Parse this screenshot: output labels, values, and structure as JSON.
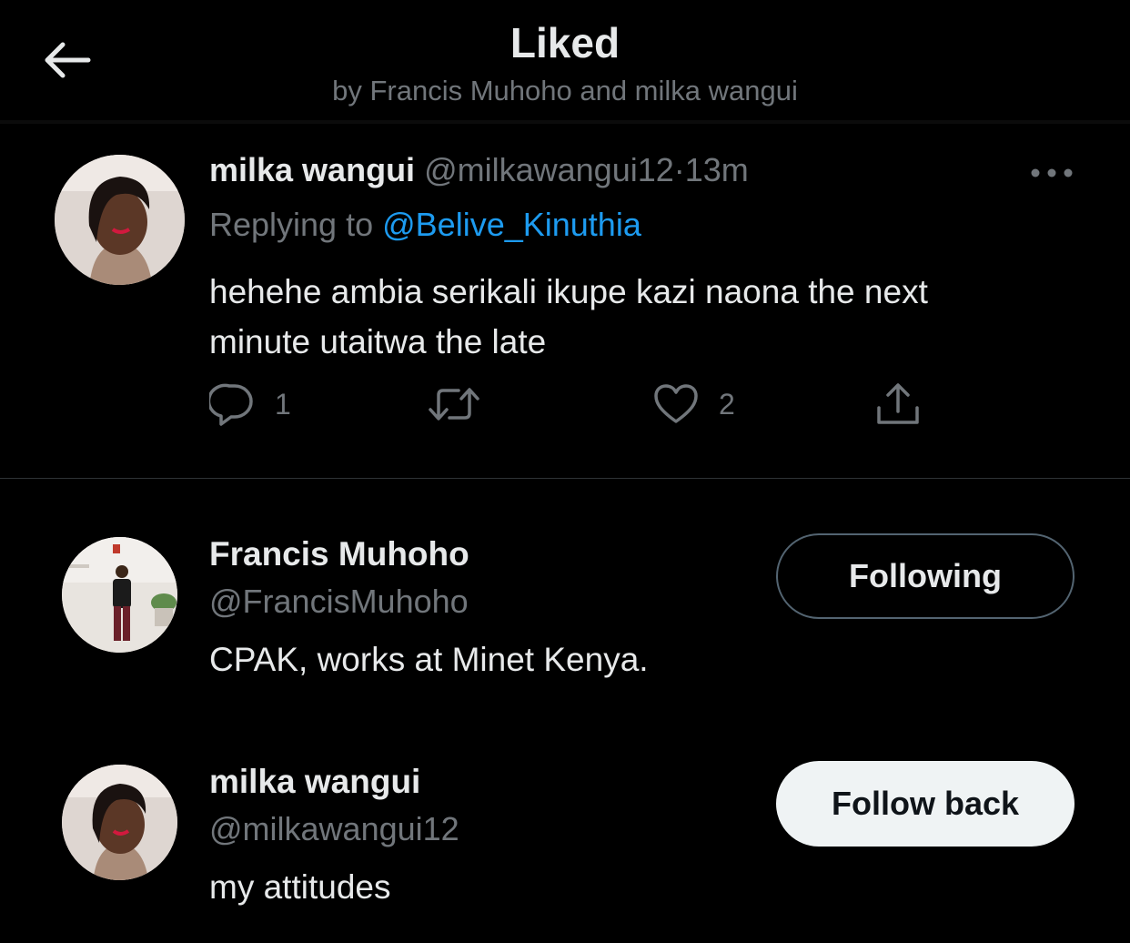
{
  "header": {
    "title": "Liked",
    "subtitle": "by Francis Muhoho and milka wangui"
  },
  "tweet": {
    "author_name": "milka wangui",
    "author_handle": "@milkawangui12",
    "separator": "·",
    "time": "13m",
    "replying_prefix": "Replying to",
    "replying_to": "@Belive_Kinuthia",
    "text_line1": "hehehe ambia serikali ikupe kazi naona the next",
    "text_line2": "minute utaitwa the late",
    "reply_count": "1",
    "retweet_count": "",
    "like_count": "2"
  },
  "users": [
    {
      "name": "Francis Muhoho",
      "handle": "@FrancisMuhoho",
      "bio": "CPAK, works at Minet Kenya.",
      "button": "Following"
    },
    {
      "name": "milka wangui",
      "handle": "@milkawangui12",
      "bio": "my attitudes",
      "button": "Follow back"
    }
  ],
  "colors": {
    "background": "#000000",
    "text_primary": "#e7e9ea",
    "text_secondary": "#71767b",
    "link": "#1d9bf0",
    "divider": "#2f3336",
    "button_solid_bg": "#eff3f4"
  },
  "icons": [
    "back-arrow-icon",
    "more-icon",
    "reply-icon",
    "retweet-icon",
    "like-icon",
    "share-icon"
  ]
}
